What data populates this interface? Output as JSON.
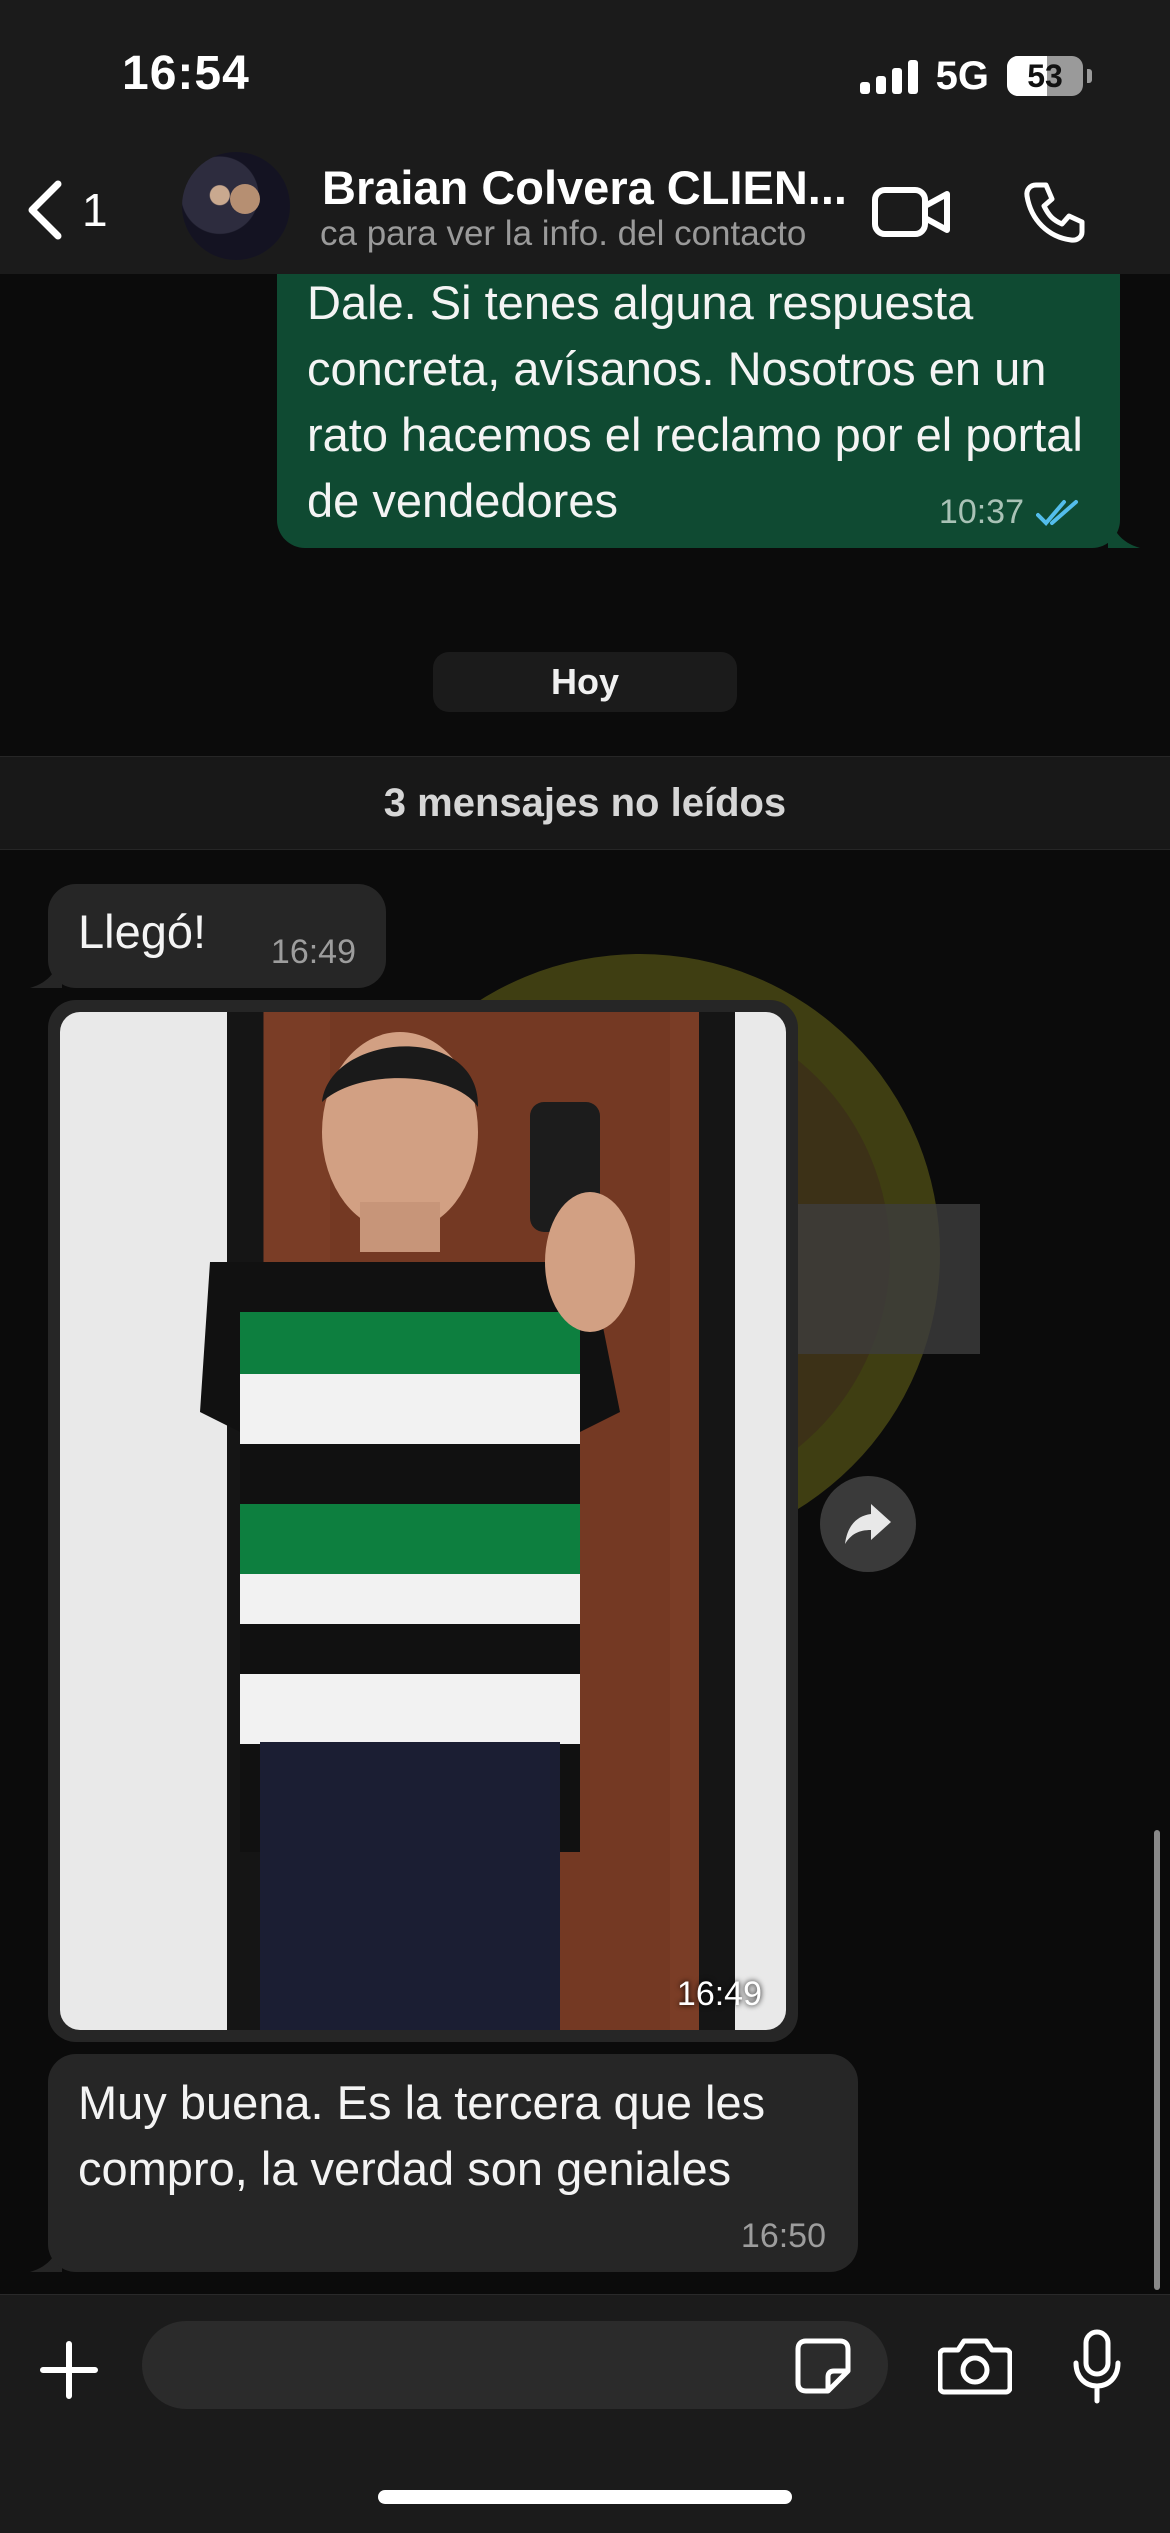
{
  "status_bar": {
    "time": "16:54",
    "network": "5G",
    "battery_percent": "53",
    "battery_level": 0.53,
    "signal_bars": 4
  },
  "header": {
    "back_count": "1",
    "contact_name": "Braian Colvera CLIEN...",
    "contact_subtitle": "ca para ver la info. del contacto",
    "icons": [
      "chevron-left-icon",
      "video-call-icon",
      "phone-icon"
    ]
  },
  "messages": [
    {
      "direction": "outgoing",
      "text": "Dale. Si tenes alguna respuesta concreta, avísanos. Nosotros en un rato hacemos el reclamo por el portal de vendedores",
      "time": "10:37",
      "status": "read"
    },
    {
      "direction": "incoming",
      "text": "Llegó!",
      "time": "16:49"
    },
    {
      "direction": "incoming",
      "type": "photo",
      "time": "16:49"
    },
    {
      "direction": "incoming",
      "text": "Muy buena. Es la tercera que les compro, la verdad son geniales",
      "time": "16:50"
    }
  ],
  "day_separator": "Hoy",
  "unread_banner": "3 mensajes no leídos",
  "composer": {
    "placeholder": "",
    "icons": [
      "plus-icon",
      "sticker-icon",
      "camera-icon",
      "microphone-icon"
    ]
  },
  "colors": {
    "background": "#0b0b0b",
    "bar": "#1b1b1b",
    "outgoing_bubble": "#0f4a32",
    "incoming_bubble": "#262626",
    "read_ticks": "#53bdeb"
  }
}
